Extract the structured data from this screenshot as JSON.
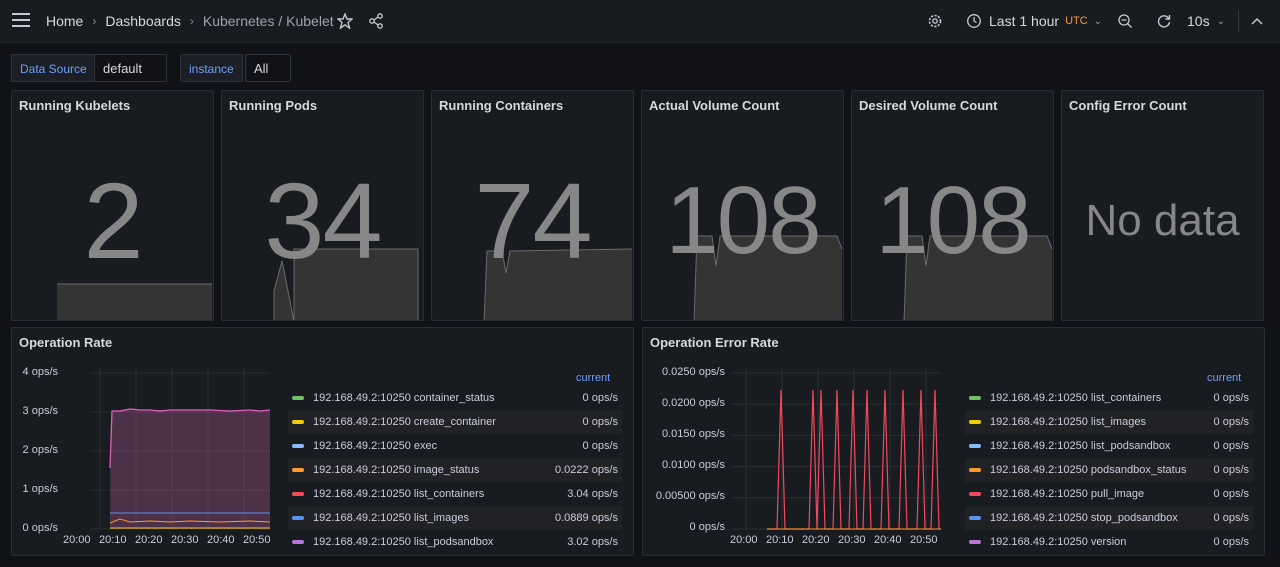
{
  "breadcrumb": {
    "home": "Home",
    "dashboards": "Dashboards",
    "current": "Kubernetes / Kubelet"
  },
  "toolbar": {
    "time_range": "Last 1 hour",
    "timezone": "UTC",
    "refresh_interval": "10s"
  },
  "variables": {
    "datasource": {
      "label": "Data Source",
      "value": "default"
    },
    "instance": {
      "label": "instance",
      "value": "All"
    }
  },
  "stats": [
    {
      "title": "Running Kubelets",
      "value": "2"
    },
    {
      "title": "Running Pods",
      "value": "34"
    },
    {
      "title": "Running Containers",
      "value": "74"
    },
    {
      "title": "Actual Volume Count",
      "value": "108"
    },
    {
      "title": "Desired Volume Count",
      "value": "108"
    },
    {
      "title": "Config Error Count",
      "value": "No data"
    }
  ],
  "op_rate": {
    "title": "Operation Rate",
    "current_label": "current",
    "y_ticks": [
      "4 ops/s",
      "3 ops/s",
      "2 ops/s",
      "1 ops/s",
      "0 ops/s"
    ],
    "x_ticks": [
      "20:00",
      "20:10",
      "20:20",
      "20:30",
      "20:40",
      "20:50"
    ],
    "legend": [
      {
        "name": "192.168.49.2:10250 container_status",
        "value": "0 ops/s",
        "color": "#73bf69"
      },
      {
        "name": "192.168.49.2:10250 create_container",
        "value": "0 ops/s",
        "color": "#f2cc0c"
      },
      {
        "name": "192.168.49.2:10250 exec",
        "value": "0 ops/s",
        "color": "#8ab8ff"
      },
      {
        "name": "192.168.49.2:10250 image_status",
        "value": "0.0222 ops/s",
        "color": "#ff9830"
      },
      {
        "name": "192.168.49.2:10250 list_containers",
        "value": "3.04 ops/s",
        "color": "#f2495c"
      },
      {
        "name": "192.168.49.2:10250 list_images",
        "value": "0.0889 ops/s",
        "color": "#5794f2"
      },
      {
        "name": "192.168.49.2:10250 list_podsandbox",
        "value": "3.02 ops/s",
        "color": "#b877d9"
      }
    ]
  },
  "op_error": {
    "title": "Operation Error Rate",
    "current_label": "current",
    "y_ticks": [
      "0.0250 ops/s",
      "0.0200 ops/s",
      "0.0150 ops/s",
      "0.0100 ops/s",
      "0.00500 ops/s",
      "0 ops/s"
    ],
    "x_ticks": [
      "20:00",
      "20:10",
      "20:20",
      "20:30",
      "20:40",
      "20:50"
    ],
    "legend": [
      {
        "name": "192.168.49.2:10250 list_containers",
        "value": "0 ops/s",
        "color": "#73bf69"
      },
      {
        "name": "192.168.49.2:10250 list_images",
        "value": "0 ops/s",
        "color": "#f2cc0c"
      },
      {
        "name": "192.168.49.2:10250 list_podsandbox",
        "value": "0 ops/s",
        "color": "#8ab8ff"
      },
      {
        "name": "192.168.49.2:10250 podsandbox_status",
        "value": "0 ops/s",
        "color": "#ff9830"
      },
      {
        "name": "192.168.49.2:10250 pull_image",
        "value": "0 ops/s",
        "color": "#f2495c"
      },
      {
        "name": "192.168.49.2:10250 stop_podsandbox",
        "value": "0 ops/s",
        "color": "#5794f2"
      },
      {
        "name": "192.168.49.2:10250 version",
        "value": "0 ops/s",
        "color": "#b877d9"
      }
    ]
  }
}
